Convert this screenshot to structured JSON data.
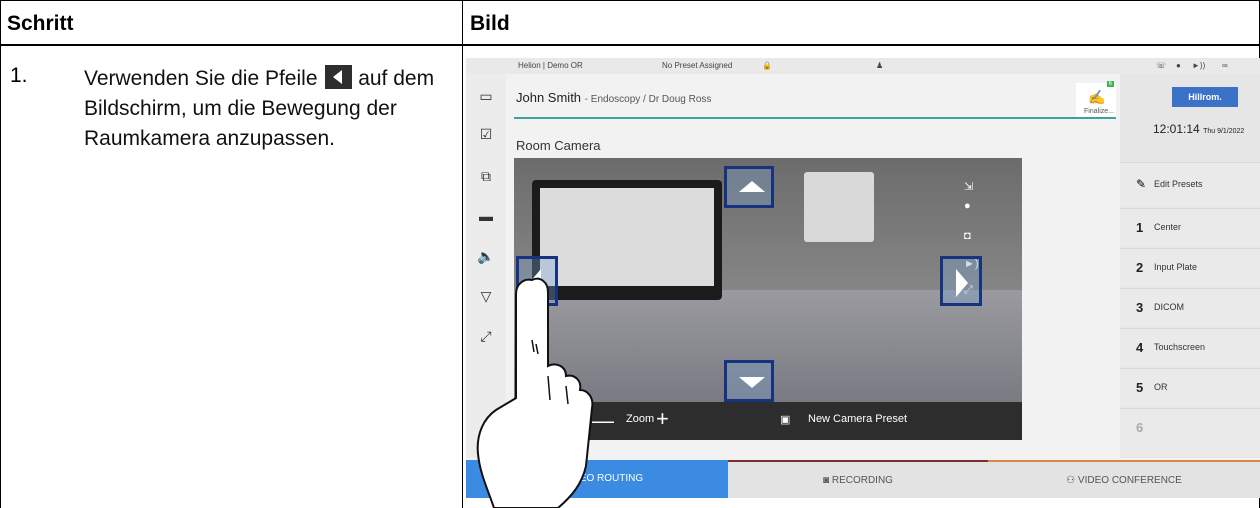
{
  "table": {
    "header_step": "Schritt",
    "header_image": "Bild"
  },
  "step": {
    "number": "1.",
    "text_before": "Verwenden Sie die Pfeile",
    "text_after": "auf dem Bildschirm, um die Bewegung der Raumkamera anzupassen."
  },
  "screen": {
    "topbar": {
      "room": "Helion | Demo OR",
      "preset": "No Preset Assigned"
    },
    "patient": {
      "name": "John Smith",
      "procedure": "- Endoscopy / Dr Doug Ross"
    },
    "finalize": "Finalize...",
    "finalize_badge": "6",
    "logo": "Hillrom.",
    "clock": {
      "time": "12:01:14",
      "date": "Thu 9/1/2022"
    },
    "room_camera_title": "Room Camera",
    "edit_presets": "Edit Presets",
    "presets": [
      {
        "num": "1",
        "label": "Center"
      },
      {
        "num": "2",
        "label": "Input Plate"
      },
      {
        "num": "3",
        "label": "DICOM"
      },
      {
        "num": "4",
        "label": "Touchscreen"
      },
      {
        "num": "5",
        "label": "OR"
      },
      {
        "num": "6",
        "label": ""
      }
    ],
    "zoom_label": "Zoom",
    "new_camera_preset": "New Camera Preset",
    "tabs": {
      "video_routing": "VIDEO ROUTING",
      "recording": "RECORDING",
      "video_conference": "VIDEO CONFERENCE"
    },
    "colors": {
      "accent_blue": "#3b8be3",
      "teal": "#3aa39b",
      "arrow_border": "#18337d"
    }
  }
}
